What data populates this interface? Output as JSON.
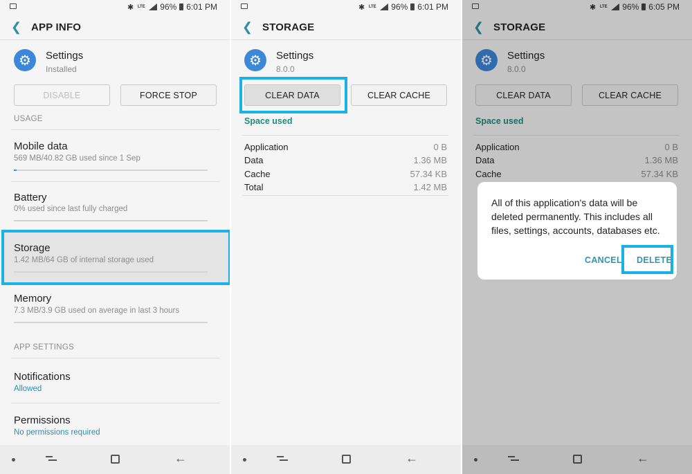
{
  "colors": {
    "accent": "#19b2e6",
    "teal": "#238a79",
    "link": "#2f95b1",
    "app_icon": "#3c87d9"
  },
  "status": {
    "screen1": {
      "battery": "96%",
      "time": "6:01 PM"
    },
    "screen2": {
      "battery": "96%",
      "time": "6:01 PM"
    },
    "screen3": {
      "battery": "96%",
      "time": "6:05 PM"
    },
    "network": "LTE"
  },
  "app_info": {
    "title": "APP INFO",
    "app_name": "Settings",
    "app_status": "Installed",
    "disable_label": "DISABLE",
    "force_stop_label": "FORCE STOP",
    "usage_header": "USAGE",
    "mobile_data": {
      "title": "Mobile data",
      "sub": "569 MB/40.82 GB used since 1 Sep",
      "usage_fraction": 0.014
    },
    "battery": {
      "title": "Battery",
      "sub": "0% used since last fully charged",
      "usage_fraction": 0
    },
    "storage": {
      "title": "Storage",
      "sub": "1.42 MB/64 GB of internal storage used"
    },
    "memory": {
      "title": "Memory",
      "sub": "7.3 MB/3.9 GB used on average in last 3 hours"
    },
    "app_settings_header": "APP SETTINGS",
    "notifications": {
      "title": "Notifications",
      "sub": "Allowed"
    },
    "permissions": {
      "title": "Permissions",
      "sub": "No permissions required"
    }
  },
  "storage": {
    "title": "STORAGE",
    "app_name": "Settings",
    "version": "8.0.0",
    "clear_data_label": "CLEAR DATA",
    "clear_cache_label": "CLEAR CACHE",
    "space_used_label": "Space used",
    "rows": [
      {
        "label": "Application",
        "value": "0 B"
      },
      {
        "label": "Data",
        "value": "1.36 MB"
      },
      {
        "label": "Cache",
        "value": "57.34 KB"
      },
      {
        "label": "Total",
        "value": "1.42 MB"
      }
    ]
  },
  "dialog": {
    "message": "All of this application's data will be deleted permanently. This includes all files, settings, accounts, databases etc.",
    "cancel_label": "CANCEL",
    "delete_label": "DELETE"
  },
  "icons": {
    "back": "chevron-left-icon",
    "app": "gear-icon",
    "nav_back": "back-arrow-icon"
  }
}
